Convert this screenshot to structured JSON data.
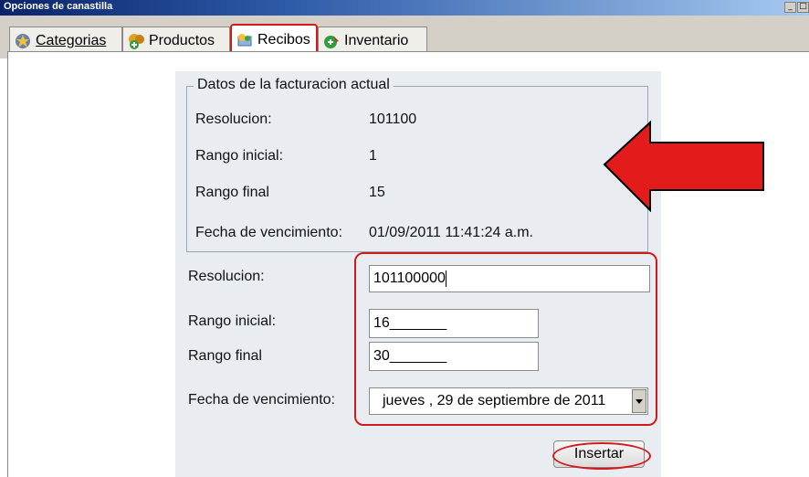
{
  "window": {
    "title": "Opciones de canastilla"
  },
  "tabs": [
    {
      "label": "Categorias"
    },
    {
      "label": "Productos"
    },
    {
      "label": "Recibos"
    },
    {
      "label": "Inventario"
    }
  ],
  "current": {
    "legend": "Datos de la facturacion actual",
    "rows": [
      {
        "label": "Resolucion:",
        "value": "101100"
      },
      {
        "label": "Rango inicial:",
        "value": "1"
      },
      {
        "label": "Rango final",
        "value": "15"
      },
      {
        "label": "Fecha de vencimiento:",
        "value": "01/09/2011 11:41:24 a.m."
      }
    ]
  },
  "form": {
    "resolucion_label": "Resolucion:",
    "resolucion_value": "101100000",
    "rango_inicial_label": "Rango inicial:",
    "rango_inicial_value": "16_______",
    "rango_final_label": "Rango final",
    "rango_final_value": "30_______",
    "fecha_label": "Fecha de vencimiento:",
    "fecha_value": "jueves   , 29 de septiembre de 2011",
    "submit_label": "Insertar"
  },
  "colors": {
    "highlight": "#d11a1a",
    "panel_bg": "#e9ecf1"
  }
}
